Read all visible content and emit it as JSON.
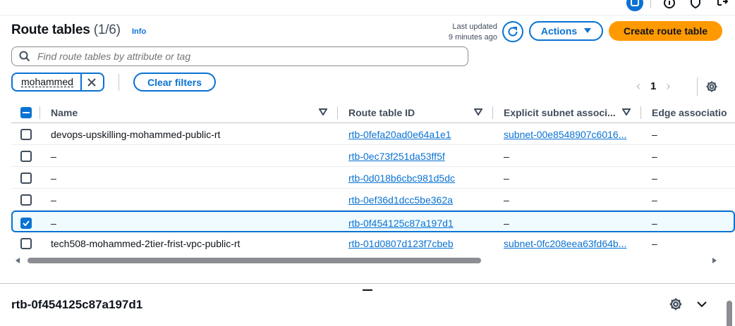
{
  "header": {
    "title": "Route tables",
    "count": "(1/6)",
    "info": "Info",
    "last_updated_line1": "Last updated",
    "last_updated_line2": "9 minutes ago",
    "actions_label": "Actions",
    "create_label": "Create route table"
  },
  "filter": {
    "search_placeholder": "Find route tables by attribute or tag",
    "token_label": "mohammed",
    "clear_label": "Clear filters"
  },
  "pagination": {
    "page": "1"
  },
  "table": {
    "columns": {
      "name": "Name",
      "route_table_id": "Route table ID",
      "explicit_subnet": "Explicit subnet associ...",
      "edge": "Edge associatio"
    },
    "rows": [
      {
        "name": "devops-upskilling-mohammed-public-rt",
        "rtb": "rtb-0fefa20ad0e64a1e1",
        "subnet": "subnet-00e8548907c6016...",
        "edge": "–",
        "selected": false
      },
      {
        "name": "–",
        "rtb": "rtb-0ec73f251da53ff5f",
        "subnet": "–",
        "edge": "–",
        "selected": false
      },
      {
        "name": "–",
        "rtb": "rtb-0d018b6cbc981d5dc",
        "subnet": "–",
        "edge": "–",
        "selected": false
      },
      {
        "name": "–",
        "rtb": "rtb-0ef36d1dcc5be362a",
        "subnet": "–",
        "edge": "–",
        "selected": false
      },
      {
        "name": "–",
        "rtb": "rtb-0f454125c87a197d1",
        "subnet": "–",
        "edge": "–",
        "selected": true
      },
      {
        "name": "tech508-mohammed-2tier-frist-vpc-public-rt",
        "rtb": "rtb-01d0807d123f7cbeb",
        "subnet": "subnet-0fc208eea63fd64b...",
        "edge": "–",
        "selected": false
      }
    ]
  },
  "detail": {
    "title": "rtb-0f454125c87a197d1"
  },
  "colors": {
    "accent": "#0972d3",
    "primary": "#ff9900",
    "text": "#0f141a"
  }
}
